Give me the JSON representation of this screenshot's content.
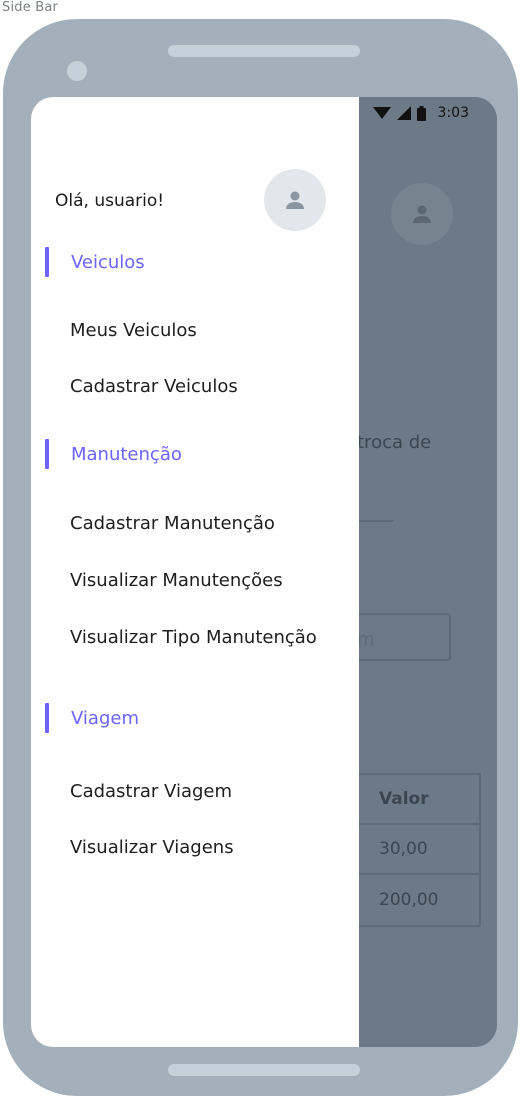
{
  "frame_label": "Side Bar",
  "status_bar": {
    "time": "3:03",
    "icons": [
      "wifi-icon",
      "cellular-signal-icon",
      "battery-icon"
    ]
  },
  "drawer": {
    "greeting": "Olá, usuario!",
    "avatar_icon": "user-icon",
    "sections": [
      {
        "header": "Veiculos",
        "items": [
          "Meus Veiculos",
          "Cadastrar Veiculos"
        ]
      },
      {
        "header": "Manutenção",
        "items": [
          "Cadastrar Manutenção",
          "Visualizar Manutenções",
          "Visualizar Tipo Manutenção"
        ]
      },
      {
        "header": "Viagem",
        "items": [
          "Cadastrar Viagem",
          "Visualizar Viagens"
        ]
      }
    ]
  },
  "background": {
    "avatar_icon": "user-icon",
    "text_fragment": "troca de",
    "input_fragment": "m",
    "table": {
      "header": "Valor",
      "rows": [
        "30,00",
        "200,00"
      ]
    }
  },
  "colors": {
    "accent": "#6c63ff",
    "phone_body": "#a3b0bc",
    "scrim": "#6b7a86"
  }
}
